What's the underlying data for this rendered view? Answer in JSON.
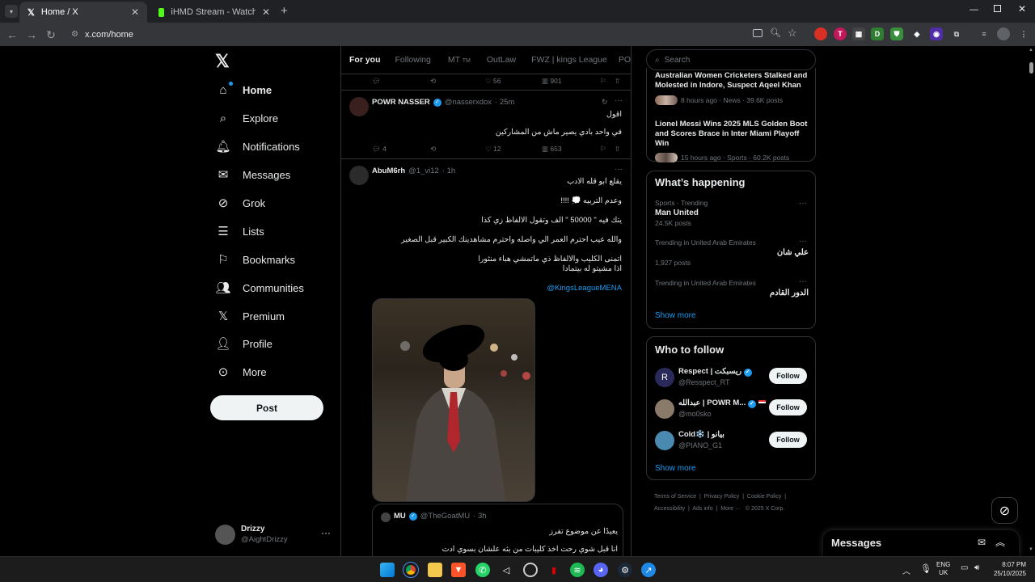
{
  "browser": {
    "tabs": [
      {
        "title": "Home / X",
        "active": true
      },
      {
        "title": "iHMD Stream - Watch Live on K",
        "active": false
      }
    ],
    "url": "x.com/home"
  },
  "sidebar": {
    "items": [
      {
        "label": "Home",
        "icon": "home-icon"
      },
      {
        "label": "Explore",
        "icon": "search-icon"
      },
      {
        "label": "Notifications",
        "icon": "bell-icon"
      },
      {
        "label": "Messages",
        "icon": "mail-icon"
      },
      {
        "label": "Grok",
        "icon": "grok-icon"
      },
      {
        "label": "Lists",
        "icon": "list-icon"
      },
      {
        "label": "Bookmarks",
        "icon": "bookmark-icon"
      },
      {
        "label": "Communities",
        "icon": "communities-icon"
      },
      {
        "label": "Premium",
        "icon": "x-icon"
      },
      {
        "label": "Profile",
        "icon": "person-icon"
      },
      {
        "label": "More",
        "icon": "more-circle-icon"
      }
    ],
    "post_label": "Post",
    "account": {
      "name": "Drizzy",
      "handle": "@AightDrizzy"
    }
  },
  "timeline": {
    "tabs": [
      "For you",
      "Following",
      "MT",
      "OutLaw",
      "FWZ | kings League",
      "POWR | ور"
    ],
    "tab_suffix": "TM",
    "top_actions": {
      "likes": "56",
      "views": "901"
    },
    "tweet1": {
      "name": "POWR NASSER",
      "handle": "@nasserxdox",
      "time": "· 25m",
      "lines": [
        "اقول",
        "في واحد بادي يصير ماش من المشاركين"
      ],
      "replies": "4",
      "likes": "12",
      "views": "653"
    },
    "tweet2": {
      "name": "AbuM6rh",
      "handle": "@1_vi12",
      "time": "· 1h",
      "lines": [
        "يقلع ابو قله الادب",
        "وعدم التربيه 💭 !!!!",
        "يتك فيه \" 50000 \" الف وتقول الالفاظ زي كذا",
        "والله عيب احترم العمر الي واصله واحترم مشاهدينك الكبير قبل الصغير",
        "اتمنى الكليب والالفاظ ذي ماتمشي هباء منثورا",
        "اذا مشيتو له بيتمادا"
      ],
      "mention": "@KingsLeagueMENA"
    },
    "quote": {
      "name": "MU",
      "handle": "@TheGoatMU",
      "time": "· 3h",
      "lines": [
        "يعيدًا عن موضوع تفرز",
        "انا قبل شوي رحت اخذ كليبات من بثه علشان بسوي ادت"
      ]
    }
  },
  "right": {
    "search_placeholder": "Search",
    "news": [
      {
        "title": "Australian Women Cricketers Stalked and Molested in Indore, Suspect Aqeel Khan ...",
        "meta": "8 hours ago · News · 39.6K posts"
      },
      {
        "title": "Lionel Messi Wins 2025 MLS Golden Boot and Scores Brace in Inter Miami Playoff Win",
        "meta": "15 hours ago · Sports · 60.2K posts"
      }
    ],
    "happening": {
      "title": "What’s happening",
      "trends": [
        {
          "context": "Sports · Trending",
          "name": "Man United",
          "posts": "24.5K posts"
        },
        {
          "context": "Trending in United Arab Emirates",
          "name": "علي شان",
          "posts": "1,927 posts"
        },
        {
          "context": "Trending in United Arab Emirates",
          "name": "الدور القادم",
          "posts": ""
        }
      ],
      "show_more": "Show more"
    },
    "who_to_follow": {
      "title": "Who to follow",
      "users": [
        {
          "name": "Respect | ريسبكت",
          "handle": "@Resspect_RT",
          "button": "Follow"
        },
        {
          "name": "عبدالله | POWR M...",
          "handle": "@mo0sko",
          "button": "Follow"
        },
        {
          "name": "Cold❄️ | بيانو",
          "handle": "@PIANO_G1",
          "button": "Follow"
        }
      ],
      "show_more": "Show more"
    },
    "footer": [
      "Terms of Service",
      "Privacy Policy",
      "Cookie Policy",
      "Accessibility",
      "Ads info",
      "More ···",
      "© 2025 X Corp."
    ]
  },
  "messages_drawer": {
    "title": "Messages"
  },
  "taskbar": {
    "lang": "ENG",
    "region": "UK",
    "time": "8:07 PM",
    "date": "25/10/2025"
  },
  "colors": {
    "accent": "#1d9bf0",
    "background": "#000000",
    "border": "#2f3336"
  }
}
